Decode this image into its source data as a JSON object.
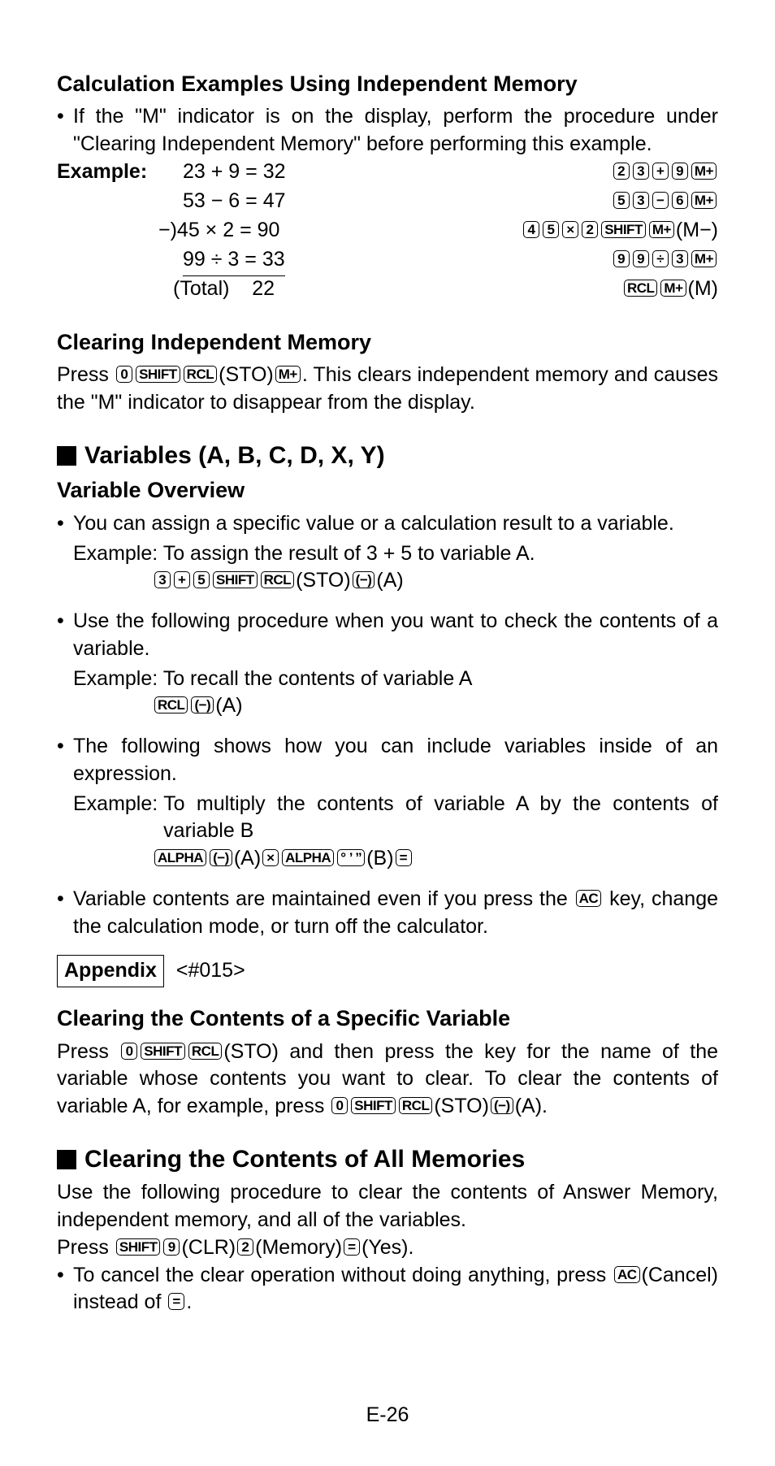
{
  "page_number": "E-26",
  "sec1": {
    "title": "Calculation Examples Using Independent Memory",
    "intro": "If the \"M\" indicator is on the display, perform the procedure under \"Clearing Independent Memory\" before performing this example.",
    "example_label": "Example:",
    "rows": [
      {
        "expr": "23 + 9 = 32",
        "suffix": ""
      },
      {
        "expr": "53 − 6 = 47",
        "suffix": ""
      },
      {
        "expr": "−)45 × 2 = 90",
        "suffix": "(M−)"
      },
      {
        "expr": "99 ÷ 3 = 33",
        "suffix": ""
      },
      {
        "expr": "(Total)    22",
        "suffix": "(M)"
      }
    ],
    "keys": {
      "r1": [
        "2",
        "3",
        "+",
        "9",
        "M+"
      ],
      "r2": [
        "5",
        "3",
        "−",
        "6",
        "M+"
      ],
      "r3": [
        "4",
        "5",
        "×",
        "2",
        "SHIFT",
        "M+"
      ],
      "r4": [
        "9",
        "9",
        "÷",
        "3",
        "M+"
      ],
      "r5": [
        "RCL",
        "M+"
      ]
    }
  },
  "sec2": {
    "title": "Clearing Independent Memory",
    "text_a": "Press",
    "text_b": "(STO)",
    "text_c": ". This clears independent memory and causes the \"M\" indicator to disappear from the display.",
    "keys": [
      "0",
      "SHIFT",
      "RCL",
      "M+"
    ]
  },
  "sec3": {
    "title": "Variables (A, B, C, D, X, Y)",
    "sub": "Variable Overview",
    "b1": "You can assign a specific value or a calculation result to a variable.",
    "b1ex": "Example: To assign the result of 3 + 5 to variable A.",
    "b1suffix": "(STO)",
    "b1suffix2": "(A)",
    "b2": "Use the following procedure when you want to check the contents of a variable.",
    "b2ex": "Example: To recall the contents of variable A",
    "b2suffix": "(A)",
    "b3": "The following shows how you can include variables inside of an expression.",
    "b3ex": "Example: To multiply the contents of variable A by the contents of variable B",
    "b3suffA": "(A)",
    "b3suffB": "(B)",
    "b4a": "Variable contents are maintained even if you press the ",
    "b4b": " key, change the calculation mode, or turn off the calculator."
  },
  "appendix": {
    "label": "Appendix",
    "ref": "<#015>"
  },
  "sec4": {
    "title": "Clearing the Contents of a Specific Variable",
    "text_a": "Press ",
    "text_b": "(STO) and then press the key for the name of the variable whose contents you want to clear. To clear the contents of variable A, for example, press ",
    "text_c": "(STO)",
    "text_d": "(A)."
  },
  "sec5": {
    "title": "Clearing the Contents of All Memories",
    "p1": "Use the following procedure to clear the contents of Answer Memory, independent memory, and all of the variables.",
    "p2a": "Press ",
    "p2b": "(CLR)",
    "p2c": "(Memory)",
    "p2d": "(Yes).",
    "b1a": "To cancel the clear operation without doing anything, press ",
    "b1b": "(Cancel) instead of ",
    "b1c": "."
  }
}
